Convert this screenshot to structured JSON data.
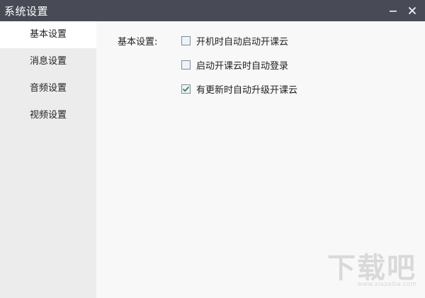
{
  "window": {
    "title": "系统设置"
  },
  "sidebar": {
    "items": [
      {
        "label": "基本设置",
        "active": true
      },
      {
        "label": "消息设置",
        "active": false
      },
      {
        "label": "音频设置",
        "active": false
      },
      {
        "label": "视频设置",
        "active": false
      }
    ]
  },
  "content": {
    "section_label": "基本设置:",
    "options": [
      {
        "label": "开机时自动启动开课云",
        "checked": false
      },
      {
        "label": "启动开课云时自动登录",
        "checked": false
      },
      {
        "label": "有更新时自动升级开课云",
        "checked": true
      }
    ]
  },
  "watermark": {
    "text": "下载吧",
    "url": "www.xiazaiba.com"
  },
  "colors": {
    "titlebar": "#484b55",
    "sidebar": "#ececec",
    "active_item": "#ffffff",
    "content_bg": "#f8f8f8",
    "checkmark": "#2f8a2f"
  },
  "icons": {
    "minimize": "minimize-icon",
    "close": "close-icon",
    "check": "checkmark-icon"
  }
}
